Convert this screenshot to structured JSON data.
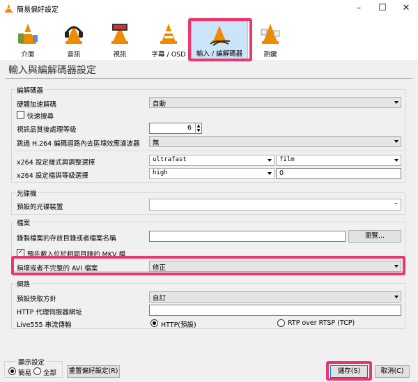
{
  "window": {
    "title": "簡易偏好設定"
  },
  "toolbar": {
    "items": [
      {
        "label": "介面"
      },
      {
        "label": "音訊"
      },
      {
        "label": "視訊"
      },
      {
        "label": "字幕 / OSD"
      },
      {
        "label": "輸入 / 編解碼器"
      },
      {
        "label": "熱鍵"
      }
    ],
    "selected": "輸入 / 編解碼器"
  },
  "page_title": "輸入與編解碼器設定",
  "codecs": {
    "group_label": "編解碼器",
    "hw_decode_label": "硬體加速解碼",
    "hw_decode_value": "自動",
    "fast_seek_label": "快速搜尋",
    "pp_level_label": "視訊品質後處理等級",
    "pp_level_value": "6",
    "skip_loop_label": "跳過 H.264 編碼迴路內去區塊效應濾波器",
    "skip_loop_value": "無",
    "x264_preset_label": "x264 設定樣式與調整選擇",
    "x264_preset_value": "ultrafast",
    "x264_tune_value": "film",
    "x264_profile_label": "x264 設定檔與等級選擇",
    "x264_profile_value": "high",
    "x264_level_value": "0"
  },
  "optical": {
    "group_label": "光碟機",
    "default_device_label": "預設的光碟裝置",
    "default_device_value": ""
  },
  "files": {
    "group_label": "檔案",
    "record_dir_label": "錄製檔案的存放目錄或者檔案名稱",
    "record_dir_value": "",
    "browse_label": "瀏覽...",
    "mkv_preload_label": "預先載入位於相同目錄的 MKV 檔",
    "avi_label": "損壞或者不完整的 AVI 檔案",
    "avi_value": "修正"
  },
  "network": {
    "group_label": "網路",
    "cache_label": "預設快取方針",
    "cache_value": "自訂",
    "proxy_label": "HTTP 代理伺服器網址",
    "proxy_value": "",
    "live555_label": "Live555 串流傳輸",
    "http_label": "HTTP(預設)",
    "rtp_label": "RTP over RTSP (TCP)"
  },
  "footer": {
    "show_settings_label": "顯示設定",
    "simple_label": "簡易",
    "all_label": "全部",
    "reset_label": "重置偏好設定(R)",
    "save_label": "儲存(S)",
    "cancel_label": "取消(C)"
  },
  "colors": {
    "highlight": "#e8386f",
    "selected_tab": "#cce4f7"
  }
}
